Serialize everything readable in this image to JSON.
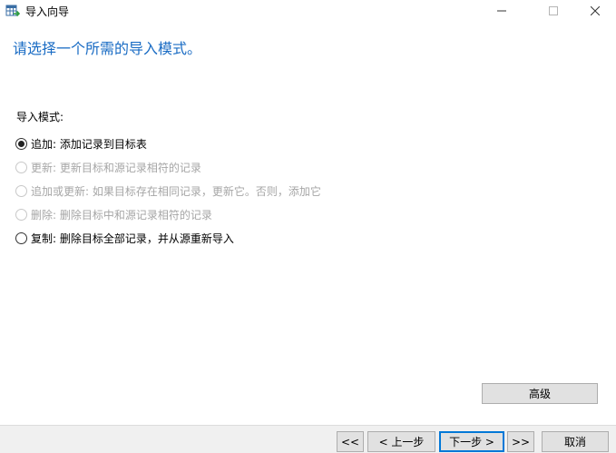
{
  "window": {
    "title": "导入向导",
    "icon": "table-import-icon",
    "controls": {
      "minimize": "minimize-icon",
      "maximize": "maximize-icon",
      "close": "close-icon"
    }
  },
  "heading": "请选择一个所需的导入模式。",
  "mode_group": {
    "label": "导入模式:",
    "options": [
      {
        "label": "追加: 添加记录到目标表",
        "checked": true,
        "disabled": false
      },
      {
        "label": "更新: 更新目标和源记录相符的记录",
        "checked": false,
        "disabled": true
      },
      {
        "label": "追加或更新: 如果目标存在相同记录，更新它。否则，添加它",
        "checked": false,
        "disabled": true
      },
      {
        "label": "删除: 删除目标中和源记录相符的记录",
        "checked": false,
        "disabled": true
      },
      {
        "label": "复制: 删除目标全部记录，并从源重新导入",
        "checked": false,
        "disabled": false
      }
    ]
  },
  "buttons": {
    "advanced": "高级",
    "first": "<<",
    "prev": "< 上一步",
    "next": "下一步 >",
    "last": ">>",
    "cancel": "取消"
  },
  "colors": {
    "heading": "#1a6cc4",
    "accent": "#0078d7",
    "disabled_text": "#a6a6a6"
  }
}
